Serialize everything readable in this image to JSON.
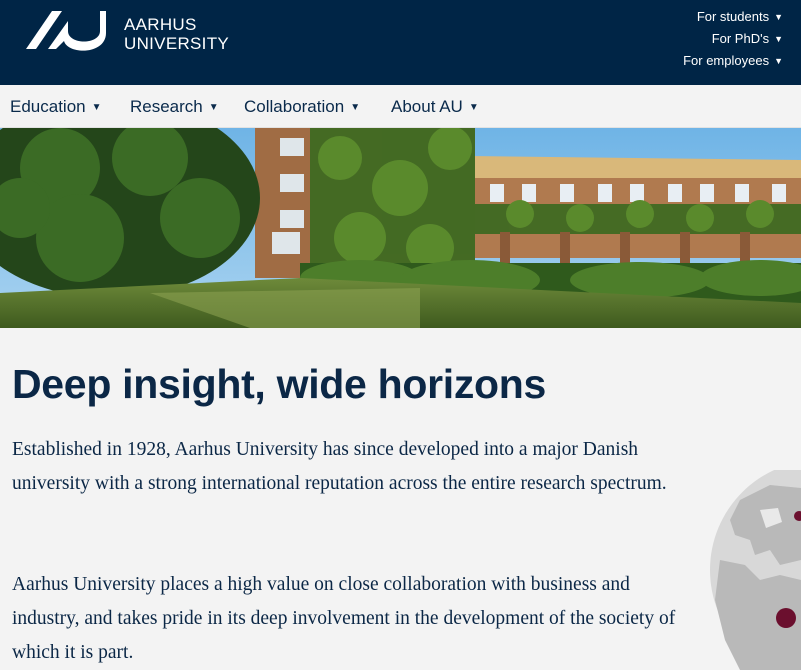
{
  "header": {
    "brand_line1": "AARHUS",
    "brand_line2": "UNIVERSITY",
    "utility_links": [
      {
        "label": "For students"
      },
      {
        "label": "For PhD's"
      },
      {
        "label": "For employees"
      }
    ]
  },
  "nav": {
    "items": [
      {
        "label": "Education"
      },
      {
        "label": "Research"
      },
      {
        "label": "Collaboration"
      },
      {
        "label": "About AU"
      }
    ]
  },
  "main": {
    "headline": "Deep insight, wide horizons",
    "paragraph1": "Established in 1928, Aarhus University has since developed into a major Danish university with a strong international reputation across the entire research spectrum.",
    "paragraph2": "Aarhus University places a high value on close collaboration with business and industry, and takes pride in its deep involvement in the development of the society of which it is part."
  },
  "colors": {
    "header_bg": "#002546",
    "text": "#0b2746",
    "marker": "#6b0f2e"
  },
  "icons": [
    "au-logo-icon",
    "chevron-down-icon",
    "globe-map-icon"
  ]
}
